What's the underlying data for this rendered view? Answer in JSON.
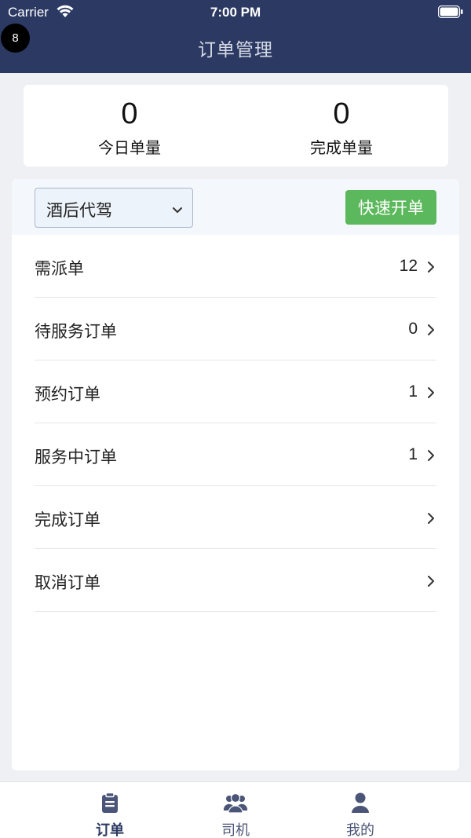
{
  "status_bar": {
    "carrier": "Carrier",
    "time": "7:00 PM"
  },
  "badge": {
    "count": "8"
  },
  "header": {
    "title": "订单管理"
  },
  "stats": [
    {
      "value": "0",
      "label": "今日单量"
    },
    {
      "value": "0",
      "label": "完成单量"
    }
  ],
  "toolbar": {
    "service_select": "酒后代驾",
    "quick_order_label": "快速开单"
  },
  "orders": [
    {
      "label": "需派单",
      "count": "12"
    },
    {
      "label": "待服务订单",
      "count": "0"
    },
    {
      "label": "预约订单",
      "count": "1"
    },
    {
      "label": "服务中订单",
      "count": "1"
    },
    {
      "label": "完成订单",
      "count": ""
    },
    {
      "label": "取消订单",
      "count": ""
    }
  ],
  "tabs": [
    {
      "label": "订单",
      "icon": "clipboard-icon",
      "active": true
    },
    {
      "label": "司机",
      "icon": "users-icon",
      "active": false
    },
    {
      "label": "我的",
      "icon": "user-icon",
      "active": false
    }
  ],
  "colors": {
    "header_bg": "#2c3a63",
    "accent_green": "#5cb85c",
    "tab_active": "#2c3a63"
  }
}
